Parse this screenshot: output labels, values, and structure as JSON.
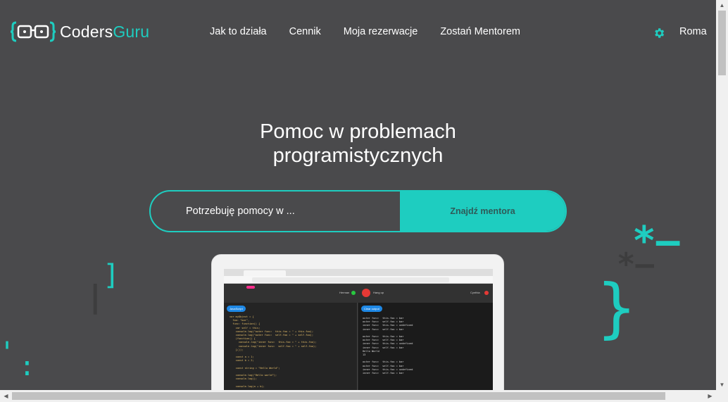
{
  "header": {
    "logo": {
      "part1": "Coders",
      "part2": "Guru",
      "icon": "glasses-brackets-icon"
    },
    "nav": [
      "Jak to działa",
      "Cennik",
      "Moja rezerwacje",
      "Zostań Mentorem"
    ],
    "settings_icon": "gear-icon",
    "user_name": "Roma"
  },
  "hero": {
    "title_line1": "Pomoc w problemach",
    "title_line2": "programistycznych",
    "search": {
      "placeholder": "Potrzebuję pomocy w ...",
      "button": "Znajdź mentora"
    }
  },
  "preview": {
    "left_pill": "JavaScript",
    "right_pill": "Clear output",
    "left_name": "Herman",
    "hangup": "Hang up",
    "right_name": "Cynthia"
  },
  "colors": {
    "accent": "#1ecdc0",
    "background": "#4a4a4c",
    "button_text": "#2f5a58"
  }
}
